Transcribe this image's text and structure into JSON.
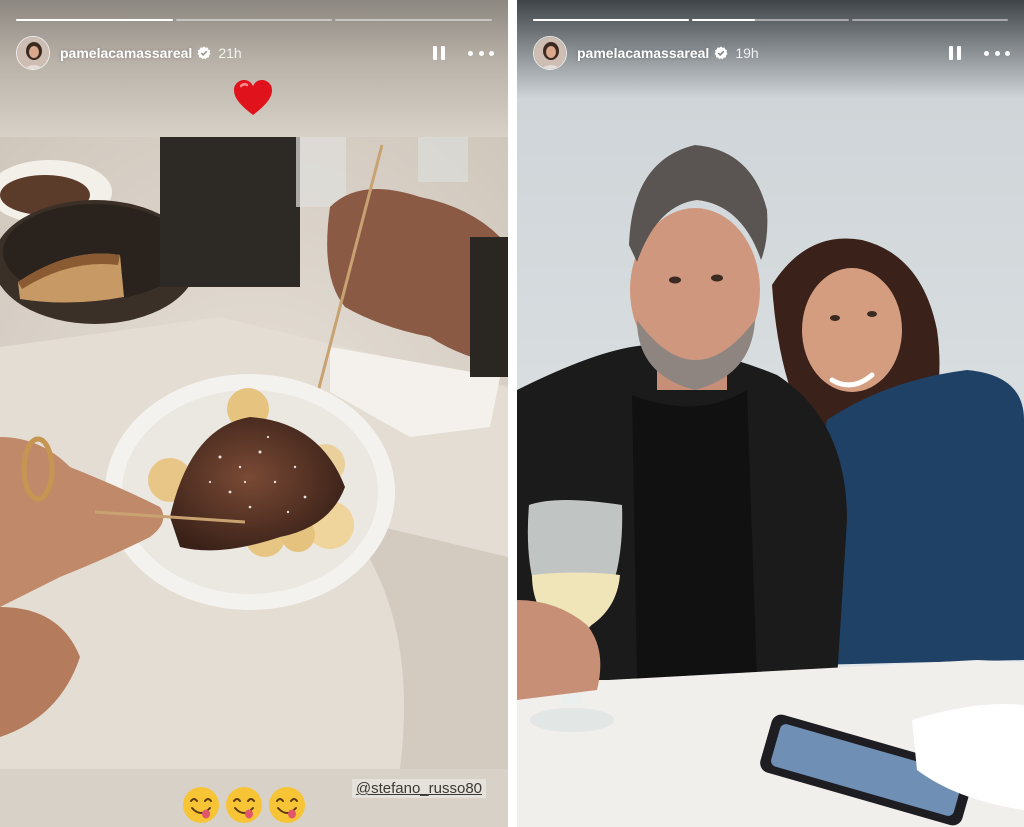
{
  "stories": [
    {
      "id": "left",
      "progress": [
        1.0,
        0.0,
        0.0
      ],
      "username": "pamelacamassareal",
      "verified": true,
      "time": "21h",
      "sticker": "heart-emoji",
      "mention": "@stefano_russo80",
      "emojis": [
        "face-savoring-food-emoji",
        "face-savoring-food-emoji",
        "face-savoring-food-emoji"
      ],
      "colors": {
        "header_bg": "#b9b2a9",
        "footer_bg": "#d8d1c8",
        "verified": "#ffffff"
      }
    },
    {
      "id": "right",
      "progress": [
        1.0,
        0.4,
        0.0
      ],
      "username": "pamelacamassareal",
      "verified": true,
      "time": "19h",
      "colors": {
        "wall": "#dfe4e6",
        "table": "#f1efec"
      }
    }
  ],
  "icons": {
    "pause": "pause-icon",
    "more": "more-options-icon",
    "verified": "verified-badge-icon"
  }
}
